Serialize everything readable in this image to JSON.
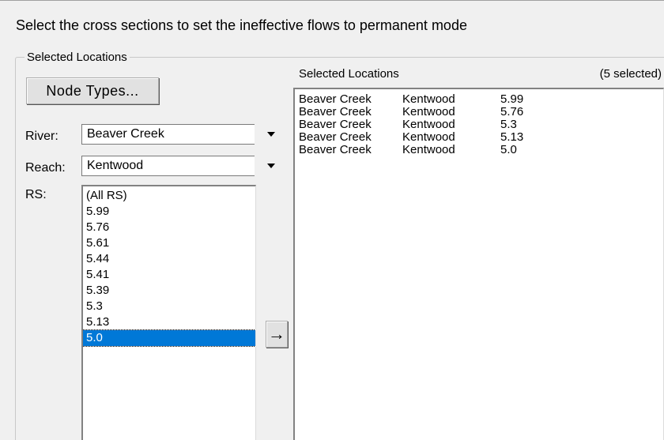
{
  "instruction": "Select the cross sections to set the ineffective flows to permanent mode",
  "group": {
    "legend": "Selected Locations"
  },
  "node_types_button": "Node Types...",
  "river": {
    "label": "River:",
    "value": "Beaver Creek"
  },
  "reach": {
    "label": "Reach:",
    "value": "Kentwood"
  },
  "rs": {
    "label": "RS:",
    "items": [
      "(All RS)",
      "5.99",
      "5.76",
      "5.61",
      "5.44",
      "5.41",
      "5.39",
      "5.3",
      "5.13",
      "5.0"
    ],
    "selected_index": 9
  },
  "add_arrow_label": "→",
  "selected": {
    "header": "Selected Locations",
    "count": "(5 selected)",
    "rows": [
      [
        "Beaver Creek",
        "Kentwood",
        "5.99"
      ],
      [
        "Beaver Creek",
        "Kentwood",
        "5.76"
      ],
      [
        "Beaver Creek",
        "Kentwood",
        "5.3"
      ],
      [
        "Beaver Creek",
        "Kentwood",
        "5.13"
      ],
      [
        "Beaver Creek",
        "Kentwood",
        "5.0"
      ]
    ]
  },
  "colors": {
    "selection": "#0078d7",
    "window_bg": "#f0f0f0"
  }
}
